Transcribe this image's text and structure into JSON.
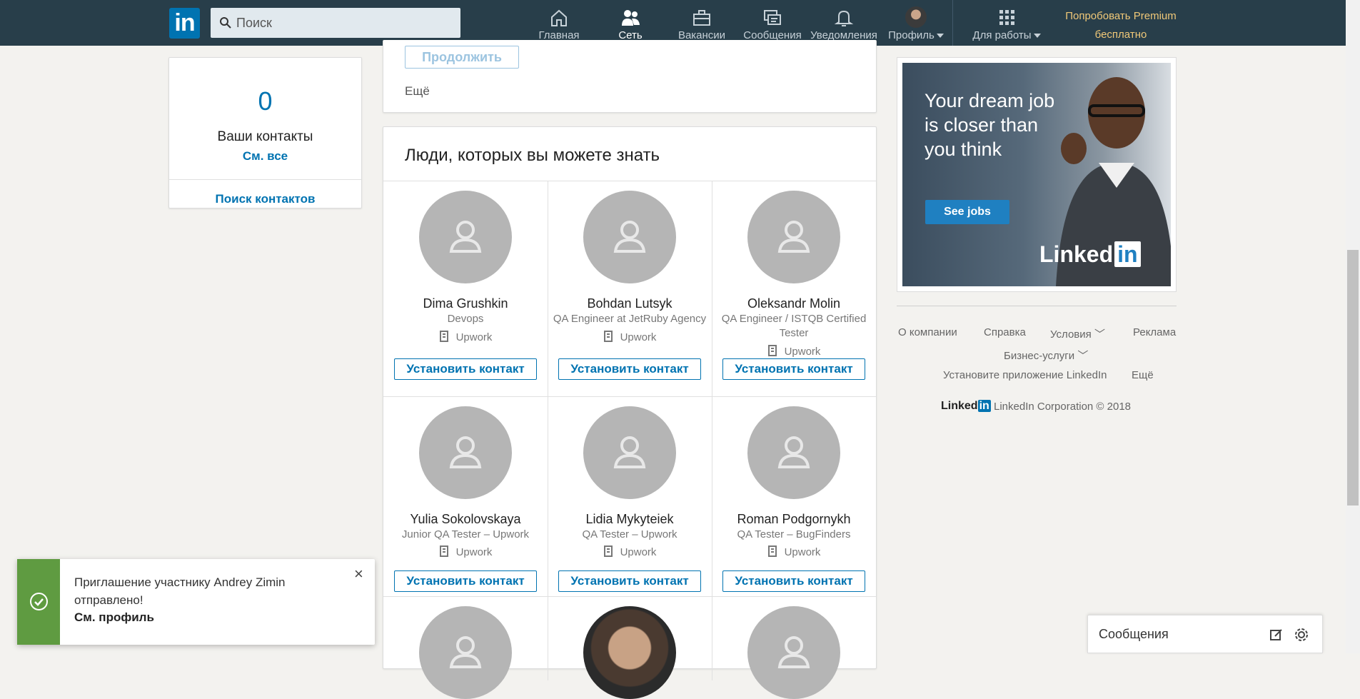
{
  "nav": {
    "logo": "in",
    "search_placeholder": "Поиск",
    "items": [
      {
        "label": "Главная",
        "icon": "home-icon"
      },
      {
        "label": "Сеть",
        "icon": "network-icon",
        "active": true
      },
      {
        "label": "Вакансии",
        "icon": "jobs-icon"
      },
      {
        "label": "Сообщения",
        "icon": "messaging-icon"
      },
      {
        "label": "Уведомления",
        "icon": "bell-icon"
      },
      {
        "label": "Профиль",
        "icon": "avatar"
      },
      {
        "label": "Для работы",
        "icon": "grid-icon"
      }
    ],
    "premium": "Попробовать Premium бесплатно"
  },
  "left": {
    "count": "0",
    "title": "Ваши контакты",
    "see_all": "См. все",
    "search": "Поиск контактов"
  },
  "top_card": {
    "continue": "Продолжить",
    "more": "Ещё"
  },
  "pymk": {
    "title": "Люди, которых вы можете знать",
    "connect_label": "Установить контакт",
    "people": [
      {
        "name": "Dima Grushkin",
        "title": "Devops",
        "company": "Upwork"
      },
      {
        "name": "Bohdan Lutsyk",
        "title": "QA Engineer at JetRuby Agency",
        "company": "Upwork"
      },
      {
        "name": "Oleksandr Molin",
        "title": "QA Engineer / ISTQB Certified Tester",
        "company": "Upwork"
      },
      {
        "name": "Yulia Sokolovskaya",
        "title": "Junior QA Tester – Upwork",
        "company": "Upwork"
      },
      {
        "name": "Lidia Mykyteiek",
        "title": "QA Tester – Upwork",
        "company": "Upwork"
      },
      {
        "name": "Roman Podgornykh",
        "title": "QA Tester – BugFinders",
        "company": "Upwork"
      }
    ]
  },
  "ad": {
    "headline": "Your dream job is closer than you think",
    "button": "See jobs",
    "logo": "Linked",
    "logo_in": "in"
  },
  "footer": {
    "links": [
      "О компании",
      "Справка",
      "Условия",
      "Реклама",
      "Бизнес-услуги",
      "Установите приложение LinkedIn",
      "Ещё"
    ],
    "brand": "Linked",
    "brand_in": "in",
    "copyright": "LinkedIn Corporation © 2018"
  },
  "toast": {
    "message": "Приглашение участнику Andrey Zimin отправлено!",
    "link": "См. профиль",
    "close": "×"
  },
  "messaging": {
    "title": "Сообщения"
  },
  "colors": {
    "nav": "#283e4a",
    "accent": "#0073b1",
    "premium": "#f0c878",
    "success": "#5f9b41"
  }
}
